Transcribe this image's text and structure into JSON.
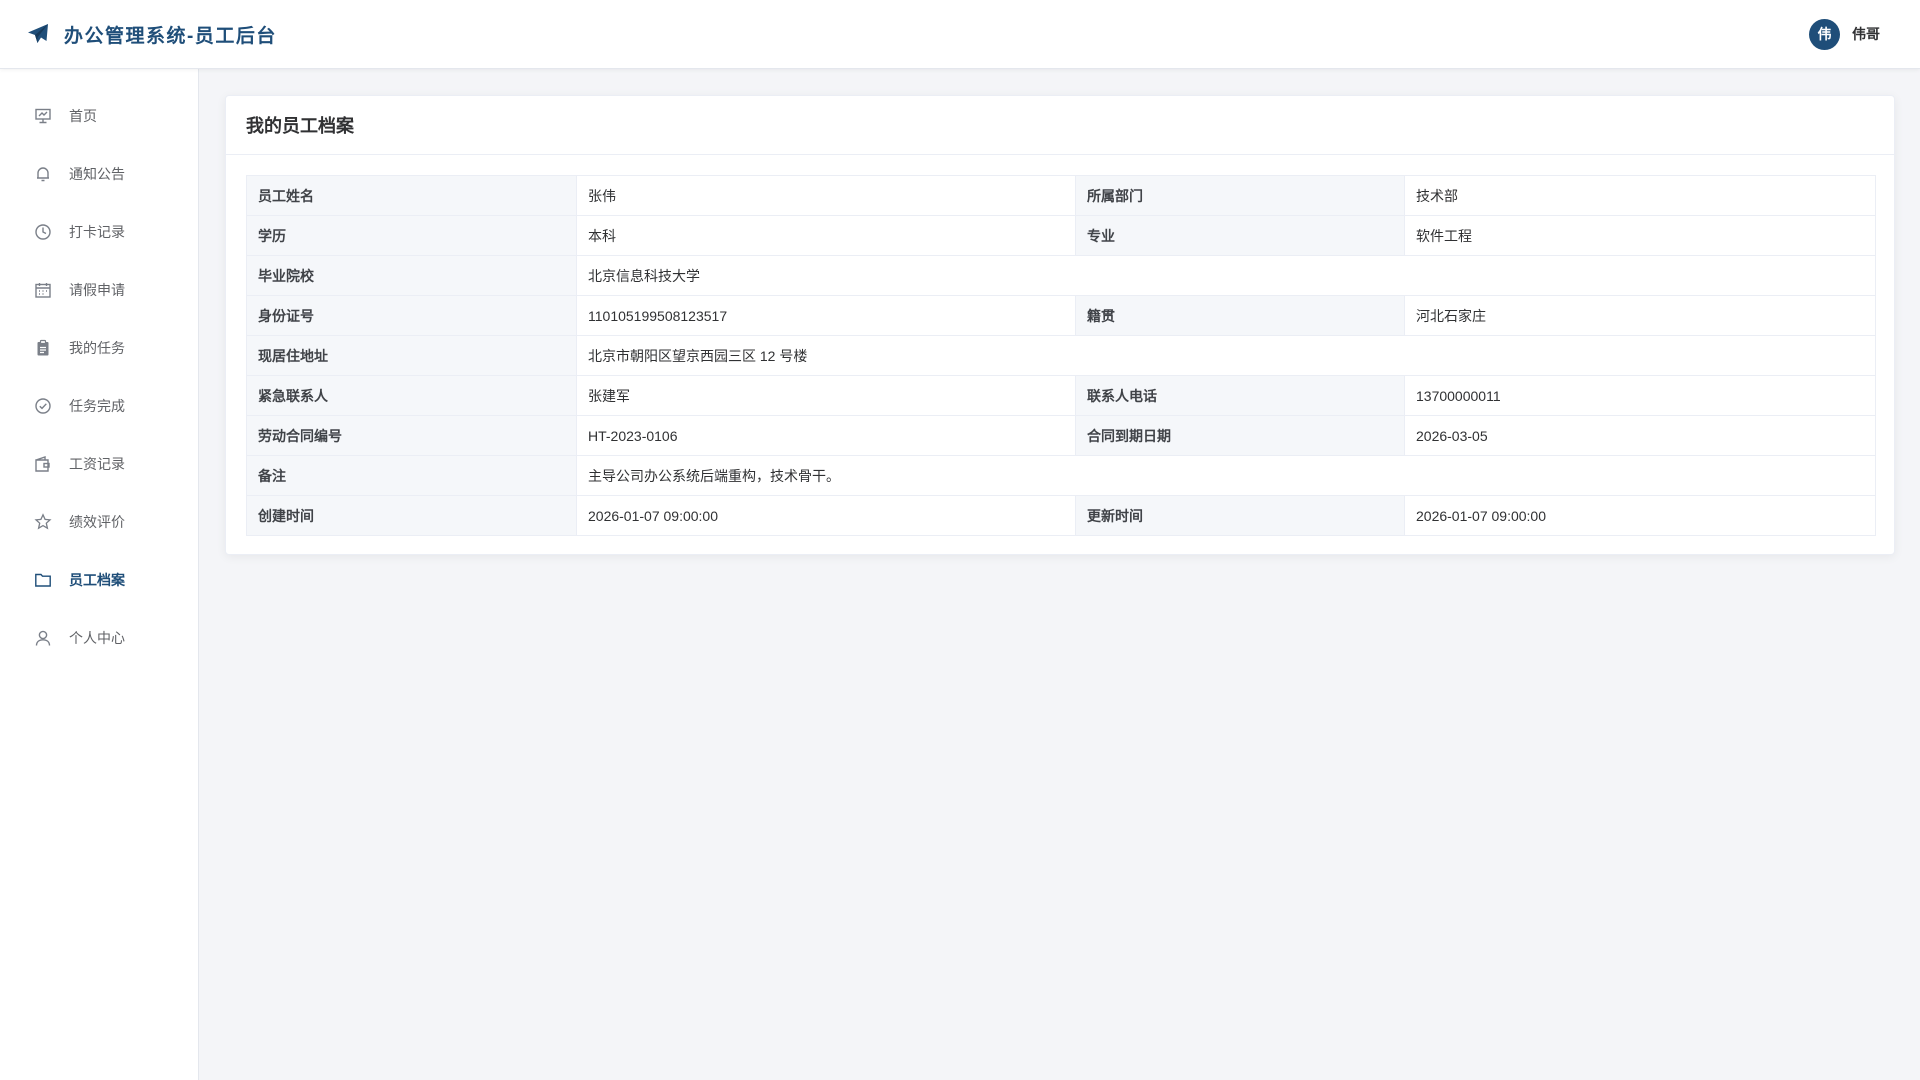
{
  "header": {
    "title": "办公管理系统-员工后台",
    "logo_icon": "paper-plane-icon",
    "user_avatar_text": "伟",
    "user_name": "伟哥",
    "brand_color": "#1f4e79"
  },
  "sidebar": {
    "items": [
      {
        "label": "首页",
        "icon": "presentation-icon",
        "active": false
      },
      {
        "label": "通知公告",
        "icon": "bell-icon",
        "active": false
      },
      {
        "label": "打卡记录",
        "icon": "clock-icon",
        "active": false
      },
      {
        "label": "请假申请",
        "icon": "calendar-icon",
        "active": false
      },
      {
        "label": "我的任务",
        "icon": "clipboard-icon",
        "active": false
      },
      {
        "label": "任务完成",
        "icon": "check-circle-icon",
        "active": false
      },
      {
        "label": "工资记录",
        "icon": "wallet-icon",
        "active": false
      },
      {
        "label": "绩效评价",
        "icon": "star-icon",
        "active": false
      },
      {
        "label": "员工档案",
        "icon": "folder-icon",
        "active": true
      },
      {
        "label": "个人中心",
        "icon": "user-icon",
        "active": false
      }
    ]
  },
  "main": {
    "card_title": "我的员工档案",
    "rows": [
      {
        "l1": "员工姓名",
        "v1": "张伟",
        "l2": "所属部门",
        "v2": "技术部"
      },
      {
        "l1": "学历",
        "v1": "本科",
        "l2": "专业",
        "v2": "软件工程"
      },
      {
        "l1": "毕业院校",
        "v1": "北京信息科技大学"
      },
      {
        "l1": "身份证号",
        "v1": "110105199508123517",
        "l2": "籍贯",
        "v2": "河北石家庄"
      },
      {
        "l1": "现居住地址",
        "v1": "北京市朝阳区望京西园三区 12 号楼"
      },
      {
        "l1": "紧急联系人",
        "v1": "张建军",
        "l2": "联系人电话",
        "v2": "13700000011"
      },
      {
        "l1": "劳动合同编号",
        "v1": "HT-2023-0106",
        "l2": "合同到期日期",
        "v2": "2026-03-05"
      },
      {
        "l1": "备注",
        "v1": "主导公司办公系统后端重构，技术骨干。"
      },
      {
        "l1": "创建时间",
        "v1": "2026-01-07 09:00:00",
        "l2": "更新时间",
        "v2": "2026-01-07 09:00:00"
      }
    ]
  }
}
